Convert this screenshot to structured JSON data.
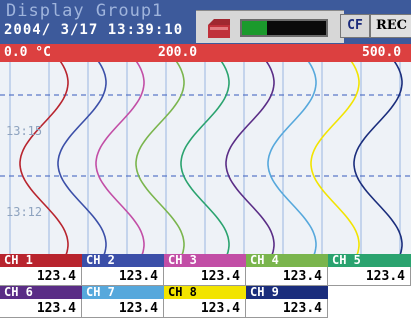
{
  "header": {
    "title": "Display Group1",
    "datetime": "2004/ 3/17 13:39:10",
    "memory_fill_fraction": 0.3,
    "cf_label": "CF",
    "rec_label": "REC"
  },
  "scale": {
    "left": "0.0 °C",
    "mid": "200.0",
    "right": "500.0"
  },
  "time_labels": [
    "13:15",
    "13:12"
  ],
  "channels": [
    {
      "name": "CH 1",
      "value": "123.4",
      "color": "#b8242e"
    },
    {
      "name": "CH 2",
      "value": "123.4",
      "color": "#3b4fa8"
    },
    {
      "name": "CH 3",
      "value": "123.4",
      "color": "#c24ea6"
    },
    {
      "name": "CH 4",
      "value": "123.4",
      "color": "#7ab54d"
    },
    {
      "name": "CH 5",
      "value": "123.4",
      "color": "#2aa36f"
    },
    {
      "name": "CH 6",
      "value": "123.4",
      "color": "#5a2d86"
    },
    {
      "name": "CH 7",
      "value": "123.4",
      "color": "#56a8dc"
    },
    {
      "name": "CH 8",
      "value": "123.4",
      "color": "#f2e400"
    },
    {
      "name": "CH 9",
      "value": "123.4",
      "color": "#1a2d7c"
    }
  ]
}
